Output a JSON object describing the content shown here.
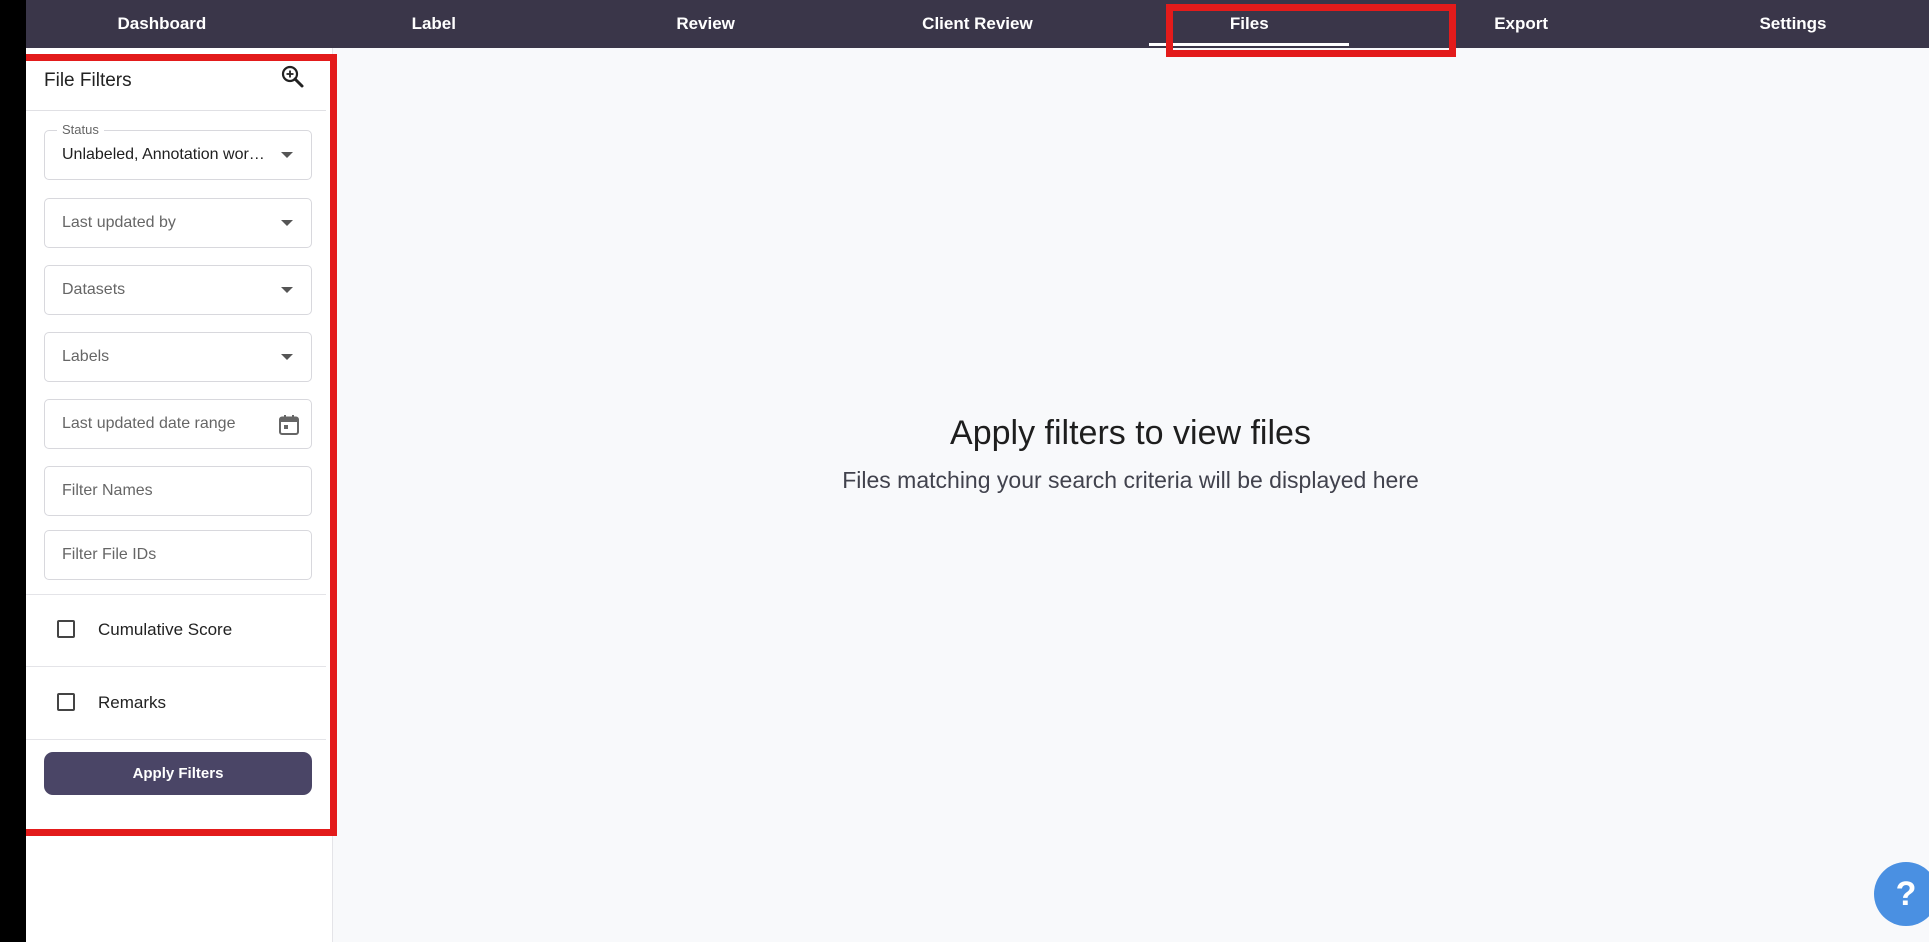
{
  "nav": {
    "tabs": [
      {
        "label": "Dashboard"
      },
      {
        "label": "Label"
      },
      {
        "label": "Review"
      },
      {
        "label": "Client Review"
      },
      {
        "label": "Files",
        "active": true
      },
      {
        "label": "Export"
      },
      {
        "label": "Settings"
      }
    ]
  },
  "filters": {
    "title": "File Filters",
    "status": {
      "label": "Status",
      "value": "Unlabeled, Annotation wor…"
    },
    "last_updated_by": {
      "placeholder": "Last updated by"
    },
    "datasets": {
      "placeholder": "Datasets"
    },
    "labels": {
      "placeholder": "Labels"
    },
    "date_range": {
      "placeholder": "Last updated date range"
    },
    "filter_names": {
      "placeholder": "Filter Names"
    },
    "filter_file_ids": {
      "placeholder": "Filter File IDs"
    },
    "cumulative_score": {
      "label": "Cumulative Score",
      "checked": false
    },
    "remarks": {
      "label": "Remarks",
      "checked": false
    },
    "apply_label": "Apply Filters"
  },
  "main": {
    "empty_title": "Apply filters to view files",
    "empty_subtitle": "Files matching your search criteria will be displayed here"
  },
  "help": {
    "label": "?"
  },
  "colors": {
    "nav_bg": "#3a3649",
    "accent": "#4a4566",
    "highlight": "#e31b1b",
    "help_button": "#4a90e2"
  }
}
